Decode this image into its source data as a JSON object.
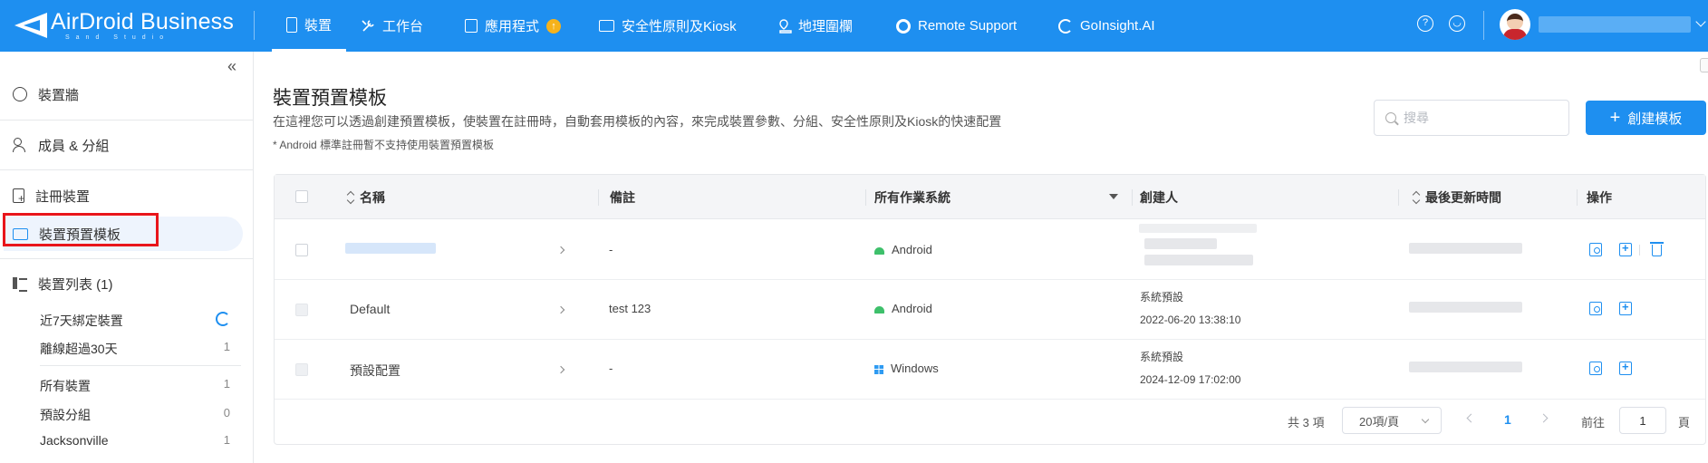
{
  "brand": {
    "name": "AirDroid Business",
    "sub": "Sand Studio"
  },
  "nav": [
    {
      "label": "裝置",
      "icon": "phone-icon",
      "active": true
    },
    {
      "label": "工作台",
      "icon": "tools-icon"
    },
    {
      "label": "應用程式",
      "icon": "app-icon",
      "badge": "↑"
    },
    {
      "label": "安全性原則及Kiosk",
      "icon": "folder-icon"
    },
    {
      "label": "地理圍欄",
      "icon": "geofence-icon"
    },
    {
      "label": "Remote Support",
      "icon": "lifebuoy-icon"
    },
    {
      "label": "GoInsight.AI",
      "icon": "goinsight-icon"
    }
  ],
  "top_right": {
    "help_icon": "help-icon",
    "support_icon": "headset-icon"
  },
  "sidebar": {
    "collapse_icon": "collapse-icon",
    "items": [
      {
        "label": "裝置牆",
        "icon": "dashboard-icon"
      },
      {
        "label": "成員 & 分組",
        "icon": "members-icon"
      },
      {
        "label": "註冊裝置",
        "icon": "register-device-icon"
      },
      {
        "label": "裝置預置模板",
        "icon": "template-icon",
        "active": true
      },
      {
        "label": "裝置列表 (1)",
        "icon": "device-list-icon"
      }
    ],
    "sub_items": [
      {
        "label": "近7天綁定裝置",
        "count": "",
        "icon": "refresh-icon"
      },
      {
        "label": "離線超過30天",
        "count": "1"
      },
      {
        "label": "所有裝置",
        "count": "1"
      },
      {
        "label": "預設分組",
        "count": "0"
      },
      {
        "label": "Jacksonville",
        "count": "1"
      }
    ]
  },
  "page": {
    "title": "裝置預置模板",
    "description": "在這裡您可以透過創建預置模板，使裝置在註冊時，自動套用模板的內容，來完成裝置參數、分組、安全性原則及Kiosk的快速配置",
    "note": "* Android 標準註冊暫不支持使用裝置預置模板",
    "search_placeholder": "搜尋",
    "create_label": "創建模板",
    "accent": "#1e8ff0"
  },
  "table": {
    "headers": {
      "name": "名稱",
      "remark": "備註",
      "os": "所有作業系統",
      "creator": "創建人",
      "updated": "最後更新時間",
      "actions": "操作"
    },
    "rows": [
      {
        "name": "",
        "remark": "-",
        "os": "Android",
        "creator": "",
        "creator_time": ""
      },
      {
        "name": "Default",
        "remark": "test 123",
        "os": "Android",
        "creator": "系統預設",
        "creator_time": "2022-06-20 13:38:10"
      },
      {
        "name": "預設配置",
        "remark": "-",
        "os": "Windows",
        "creator": "系統預設",
        "creator_time": "2024-12-09 17:02:00"
      }
    ]
  },
  "pagination": {
    "total": "共 3 項",
    "page_size": "20項/頁",
    "current_page": "1",
    "goto_label": "前往",
    "goto_value": "1",
    "page_word": "頁"
  }
}
